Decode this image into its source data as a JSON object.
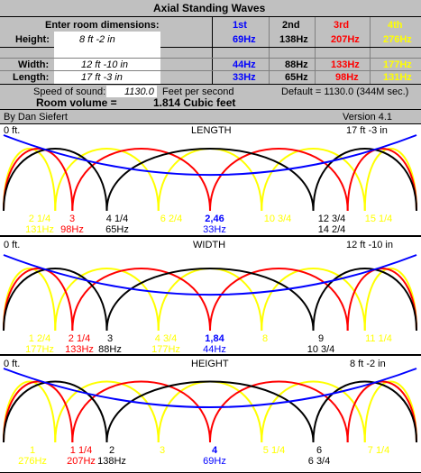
{
  "title": "Axial Standing Waves",
  "enter_label": "Enter room dimensions:",
  "harmonics": {
    "h1": "1st",
    "h2": "2nd",
    "h3": "3rd",
    "h4": "4th"
  },
  "height": {
    "label": "Height:",
    "value": "8 ft  -2 in",
    "f1": "69Hz",
    "f2": "138Hz",
    "f3": "207Hz",
    "f4": "276Hz"
  },
  "width": {
    "label": "Width:",
    "value": "12 ft  -10 in",
    "f1": "44Hz",
    "f2": "88Hz",
    "f3": "133Hz",
    "f4": "177Hz"
  },
  "length": {
    "label": "Length:",
    "value": "17 ft  -3 in",
    "f1": "33Hz",
    "f2": "65Hz",
    "f3": "98Hz",
    "f4": "131Hz"
  },
  "speed": {
    "label": "Speed of sound:",
    "value": "1130.0",
    "unit": "Feet per second",
    "default": "Default = 1130.0 (344M sec.)"
  },
  "volume": {
    "label": "Room volume =",
    "value": "1.814 Cubic feet"
  },
  "author": "By Dan Siefert",
  "version": "Version 4.1",
  "panels": {
    "length": {
      "name": "LENGTH",
      "start": "0 ft.",
      "end": "17 ft  -3 in",
      "nodes": [
        {
          "pos": "2 1/4",
          "freq": "131Hz",
          "color": "#ffff00"
        },
        {
          "pos": "3",
          "freq": "98Hz",
          "color": "#ff0000"
        },
        {
          "pos": "4 1/4",
          "freq": "65Hz",
          "color": "#000000"
        },
        {
          "pos": "6 2/4",
          "freq": "",
          "color": "#ffff00"
        },
        {
          "pos": "2,46",
          "freq": "33Hz",
          "color": "#0000ff"
        },
        {
          "pos": "10 3/4",
          "freq": "",
          "color": "#ffff00"
        },
        {
          "pos": "12 3/4",
          "freq": "14 2/4",
          "color": "#000000"
        },
        {
          "pos": "15 1/4",
          "freq": "",
          "color": "#ffff00"
        }
      ]
    },
    "width": {
      "name": "WIDTH",
      "start": "0 ft.",
      "end": "12 ft  -10 in",
      "nodes": [
        {
          "pos": "1 2/4",
          "freq": "177Hz",
          "color": "#ffff00"
        },
        {
          "pos": "2 1/4",
          "freq": "133Hz",
          "color": "#ff0000"
        },
        {
          "pos": "3",
          "freq": "88Hz",
          "color": "#000000"
        },
        {
          "pos": "4 3/4",
          "freq": "177Hz",
          "color": "#ffff00"
        },
        {
          "pos": "1,84",
          "freq": "44Hz",
          "color": "#0000ff"
        },
        {
          "pos": "8",
          "freq": "",
          "color": "#ffff00"
        },
        {
          "pos": "9",
          "freq": "10 3/4",
          "color": "#000000"
        },
        {
          "pos": "11 1/4",
          "freq": "",
          "color": "#ffff00"
        }
      ]
    },
    "height": {
      "name": "HEIGHT",
      "start": "0 ft.",
      "end": "8 ft  -2 in",
      "nodes": [
        {
          "pos": "1",
          "freq": "276Hz",
          "color": "#ffff00"
        },
        {
          "pos": "1 1/4",
          "freq": "207Hz",
          "color": "#ff0000"
        },
        {
          "pos": "2",
          "freq": "138Hz",
          "color": "#000000"
        },
        {
          "pos": "3",
          "freq": "",
          "color": "#ffff00"
        },
        {
          "pos": "4",
          "freq": "69Hz",
          "color": "#0000ff"
        },
        {
          "pos": "5 1/4",
          "freq": "",
          "color": "#ffff00"
        },
        {
          "pos": "6",
          "freq": "6 3/4",
          "color": "#000000"
        },
        {
          "pos": "7 1/4",
          "freq": "",
          "color": "#ffff00"
        }
      ]
    }
  },
  "colors": {
    "first": "#0000ff",
    "second": "#000000",
    "third": "#ff0000",
    "fourth": "#ffff00",
    "background": "#c0c0c0"
  }
}
